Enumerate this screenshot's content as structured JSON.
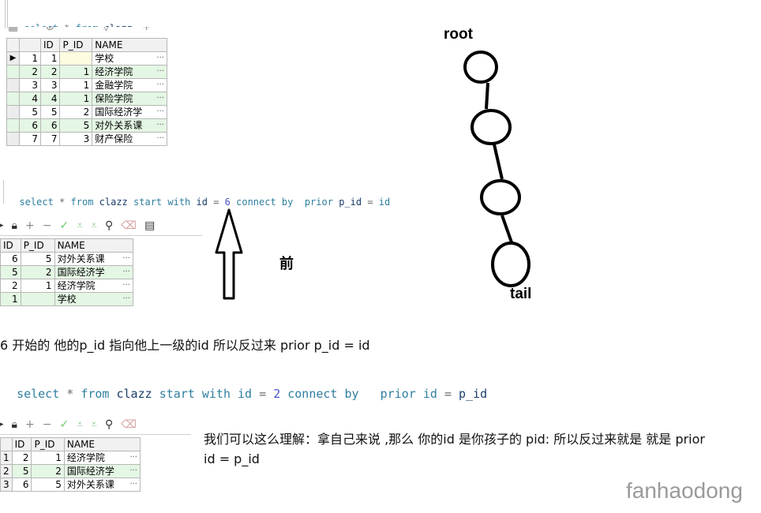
{
  "sql1": {
    "kw1": "select",
    "op": "*",
    "kw2": "from",
    "table": "clazz"
  },
  "sql2": {
    "kw1": "select",
    "op": "*",
    "kw2": "from",
    "table": "clazz",
    "start": "start with",
    "col1": "id",
    "eq1": "=",
    "num": "6",
    "connect": "connect by",
    "prior": "prior",
    "col2": "p_id",
    "eq2": "=",
    "col3": "id"
  },
  "sql3": {
    "kw1": "select",
    "op": "*",
    "kw2": "from",
    "table": "clazz",
    "start": "start with",
    "col1": "id",
    "eq1": "=",
    "num": "2",
    "connect": "connect by",
    "prior": "prior",
    "col2": "id",
    "eq2": "=",
    "col3": "p_id"
  },
  "table1": {
    "headers": [
      "ID",
      "P_ID",
      "NAME"
    ],
    "rows": [
      {
        "rownum": "1",
        "id": "1",
        "pid": "",
        "name": "学校"
      },
      {
        "rownum": "2",
        "id": "2",
        "pid": "1",
        "name": "经济学院"
      },
      {
        "rownum": "3",
        "id": "3",
        "pid": "1",
        "name": "金融学院"
      },
      {
        "rownum": "4",
        "id": "4",
        "pid": "1",
        "name": "保险学院"
      },
      {
        "rownum": "5",
        "id": "5",
        "pid": "2",
        "name": "国际经济学"
      },
      {
        "rownum": "6",
        "id": "6",
        "pid": "5",
        "name": "对外关系课"
      },
      {
        "rownum": "7",
        "id": "7",
        "pid": "3",
        "name": "财产保险"
      }
    ]
  },
  "table2": {
    "headers": [
      "ID",
      "P_ID",
      "NAME"
    ],
    "rows": [
      {
        "id": "6",
        "pid": "5",
        "name": "对外关系课"
      },
      {
        "id": "5",
        "pid": "2",
        "name": "国际经济学"
      },
      {
        "id": "2",
        "pid": "1",
        "name": "经济学院"
      },
      {
        "id": "1",
        "pid": "",
        "name": "学校"
      }
    ]
  },
  "table3": {
    "headers": [
      "ID",
      "P_ID",
      "NAME"
    ],
    "rows": [
      {
        "rownum": "1",
        "id": "2",
        "pid": "1",
        "name": "经济学院"
      },
      {
        "rownum": "2",
        "id": "5",
        "pid": "2",
        "name": "国际经济学"
      },
      {
        "rownum": "3",
        "id": "6",
        "pid": "5",
        "name": "对外关系课"
      }
    ]
  },
  "ellipsis": "···",
  "arrow_label": "前",
  "tree": {
    "root": "root",
    "tail": "tail"
  },
  "note1": "6 开始的  他的p_id  指向他上一级的id   所以反过来 prior p_id = id",
  "note2_line1": "我们可以这么理解：拿自己来说 ,那么 你的id 是你孩子的 pid:  所以反过来就是 就是 prior",
  "note2_line2": "id = p_id",
  "watermark": "fanhaodong",
  "colors": {
    "row_alt": "#e4f6e4",
    "keyword": "#2f7f9f",
    "number": "#4a55c9"
  }
}
